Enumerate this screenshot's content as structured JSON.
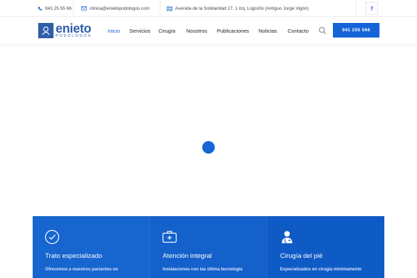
{
  "topbar": {
    "phone": "941 25 55 66",
    "email": "clinica@enietopodologos.com",
    "address": "Avenida de la Solidaridad 27, 1 izq. Logroño (Antiguo Jorge Vigón)",
    "facebook": "f",
    "phone_icon": "phone-icon",
    "email_icon": "envelope-icon",
    "address_icon": "map-icon"
  },
  "header": {
    "logo_name": "enieto",
    "logo_sub": "PODÓLOGOS",
    "nav": [
      "Inicio",
      "Servicios",
      "Cirugía",
      "Nosotros",
      "Publicaciones",
      "Noticias",
      "Contacto"
    ],
    "active_nav": "Inicio",
    "cta": "941 255 566",
    "accent": "#1565d8"
  },
  "features": [
    {
      "icon": "check-circle-icon",
      "title": "Trato especializado",
      "text": "Ofrecemos a nuestros pacientes un"
    },
    {
      "icon": "first-aid-kit-icon",
      "title": "Atención integral",
      "text": "Instalaciones con  las última tecnología"
    },
    {
      "icon": "doctor-icon",
      "title": "Cirugía del pié",
      "text": "Especializados en cirugía mínimamente"
    }
  ],
  "colors": {
    "primary": "#1565d8",
    "feature_bg": "#1765cf"
  }
}
